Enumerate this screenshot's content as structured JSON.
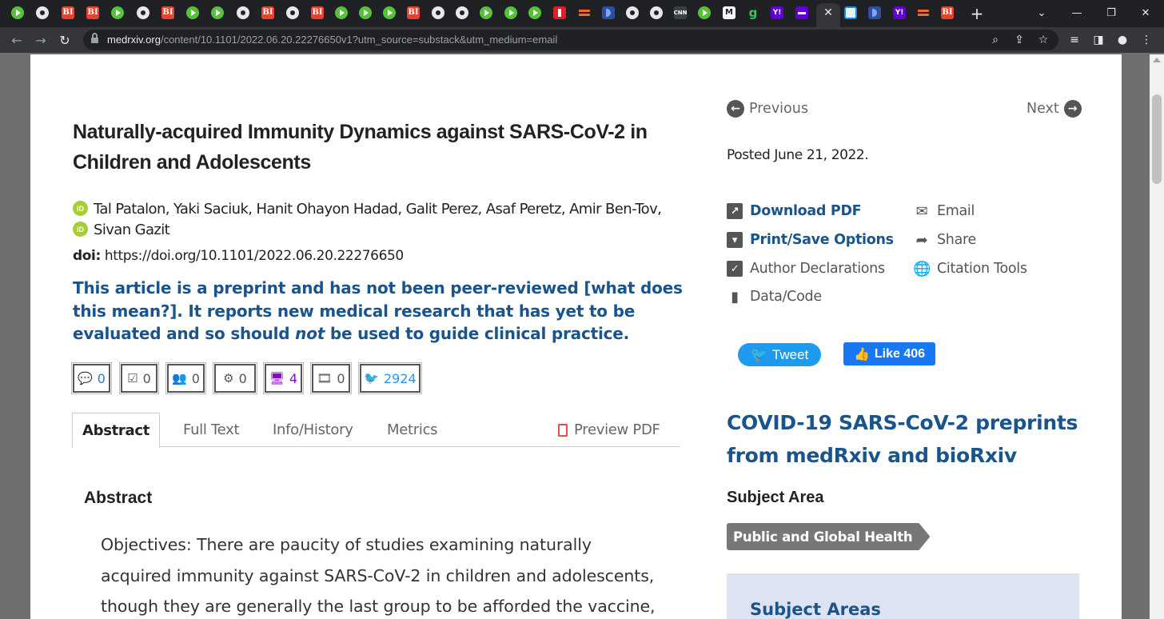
{
  "browser": {
    "url_host": "medrxiv.org",
    "url_path": "/content/10.1101/2022.06.20.22276650v1?utm_source=substack&utm_medium=email",
    "tab_icons": [
      "play-icon",
      "circle-icon",
      "bi-icon",
      "bi-icon",
      "play-icon",
      "circle-icon",
      "bi-icon",
      "play-icon",
      "play-icon",
      "circle-icon",
      "bi-icon",
      "circle-icon",
      "bi-icon",
      "play-icon",
      "play-icon",
      "play-icon",
      "bi-icon",
      "circle-icon",
      "circle-icon",
      "play-icon",
      "play-icon",
      "play-icon",
      "red-icon",
      "stack-icon",
      "blue-icon",
      "circle-icon",
      "circle-icon",
      "grey-icon",
      "play-icon",
      "m-icon",
      "g-icon",
      "yf-icon",
      "purple-icon",
      "active-tab",
      "chart-icon",
      "blue-icon",
      "yf-icon",
      "stack-icon",
      "bi-icon"
    ],
    "bi_label": "BI",
    "yf_label": "Y!",
    "g_label": "g",
    "m_label": "M",
    "grey_label": "CNN"
  },
  "article": {
    "title": "Naturally-acquired Immunity Dynamics against SARS-CoV-2 in Children and Adolescents",
    "authors_line1": "Tal Patalon, Yaki Saciuk, Hanit Ohayon Hadad, Galit Perez, Asaf Peretz, Amir Ben-Tov,",
    "authors_line2": "Sivan Gazit",
    "orcid_label": "iD",
    "doi_label": "doi:",
    "doi_value": "https://doi.org/10.1101/2022.06.20.22276650",
    "notice_part1": "This article is a preprint and has not been peer-reviewed [what does this mean?]. It reports new medical research that has yet to be evaluated and so should ",
    "notice_not": "not",
    "notice_part2": " be used to guide clinical practice."
  },
  "metrics": [
    {
      "icon": "comment-icon",
      "glyph": "💬",
      "count": "0",
      "color": "#337ab7"
    },
    {
      "icon": "checkbox-icon",
      "glyph": "☑",
      "count": "0",
      "color": "#555555"
    },
    {
      "icon": "users-icon",
      "glyph": "👥",
      "count": "0",
      "color": "#555555"
    },
    {
      "icon": "cogs-icon",
      "glyph": "⚙",
      "count": "0",
      "color": "#555555"
    },
    {
      "icon": "monitor-icon",
      "glyph": "🖥",
      "count": "4",
      "color": "#8b0ac7"
    },
    {
      "icon": "film-icon",
      "glyph": "🎞",
      "count": "0",
      "color": "#555555"
    },
    {
      "icon": "twitter-icon",
      "glyph": "🐦",
      "count": "2924",
      "color": "#1d9bf0"
    }
  ],
  "tabs": {
    "abstract": "Abstract",
    "full_text": "Full Text",
    "info_history": "Info/History",
    "metrics": "Metrics",
    "preview_pdf": "Preview PDF"
  },
  "abstract": {
    "heading": "Abstract",
    "text": "Objectives: There are paucity of studies examining naturally acquired immunity against SARS-CoV-2 in children and adolescents, though they are generally the last group to be afforded the vaccine,"
  },
  "sidebar": {
    "previous": "Previous",
    "next": "Next",
    "posted": "Posted June 21, 2022.",
    "download_pdf": "Download PDF",
    "print_save": "Print/Save Options",
    "author_declarations": "Author Declarations",
    "data_code": "Data/Code",
    "email": "Email",
    "share": "Share",
    "citation_tools": "Citation Tools",
    "tweet": "Tweet",
    "like": "Like 406",
    "covid_heading": "COVID-19 SARS-CoV-2 preprints from medRxiv and bioRxiv",
    "subject_area_heading": "Subject Area",
    "subject_tag": "Public and Global Health",
    "subject_areas_title": "Subject Areas"
  }
}
